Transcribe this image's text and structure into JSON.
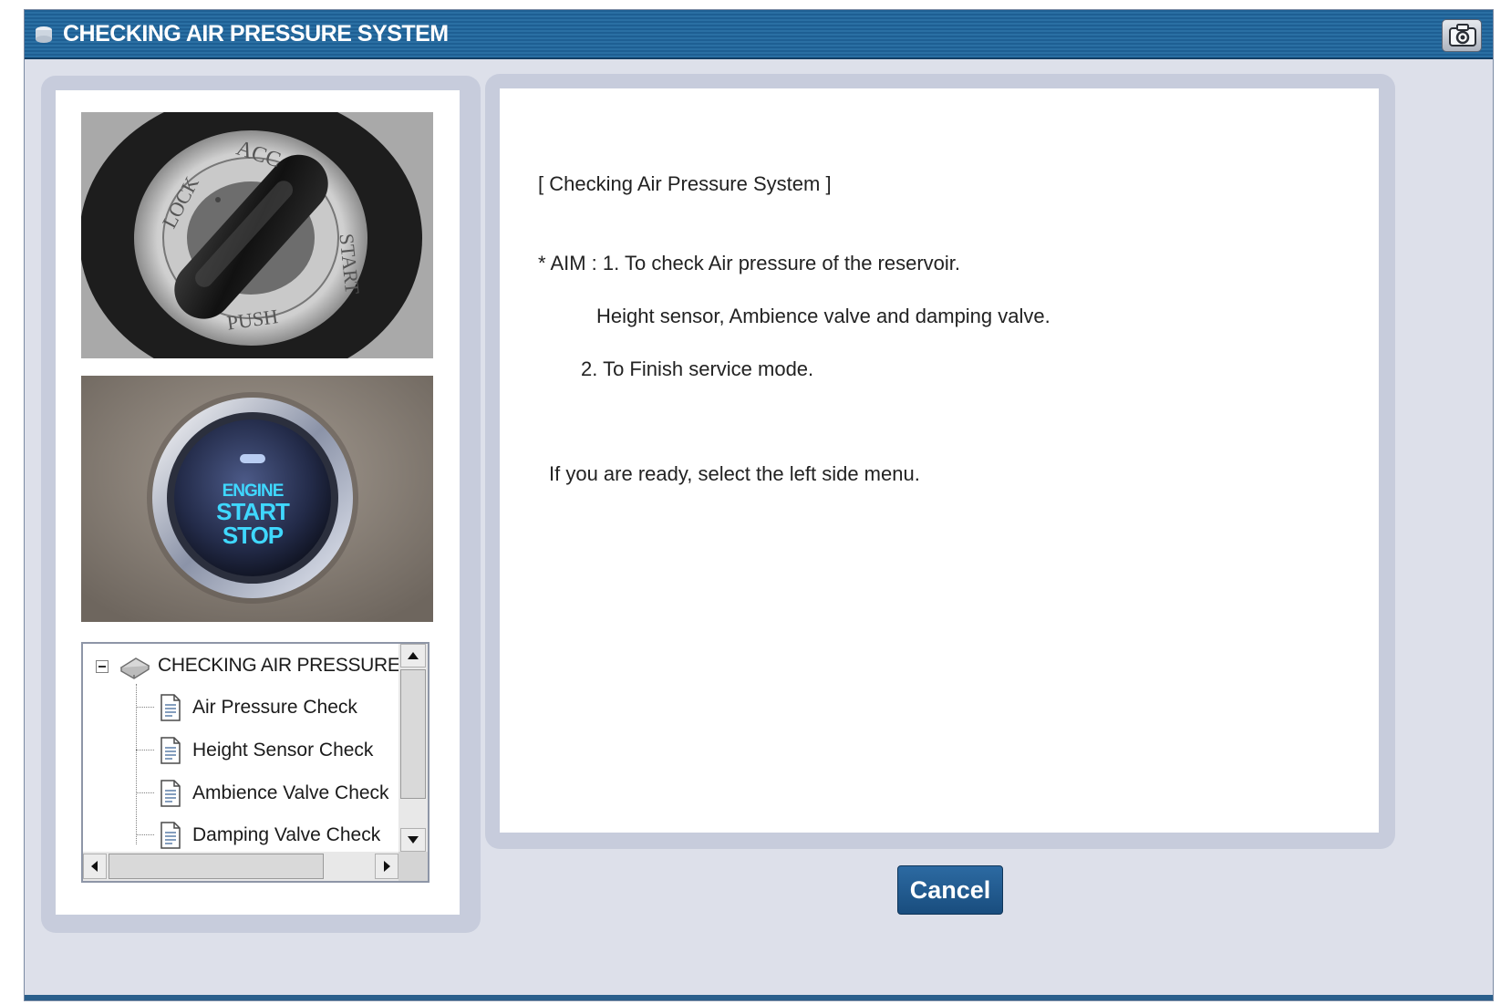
{
  "window": {
    "title": "CHECKING AIR PRESSURE SYSTEM",
    "titlebar_color": "#1e5f93"
  },
  "toolbar": {
    "camera_icon": "camera-icon"
  },
  "tree": {
    "root_label": "CHECKING AIR PRESSURE S",
    "items": [
      {
        "label": "Air Pressure Check"
      },
      {
        "label": "Height Sensor Check"
      },
      {
        "label": "Ambience Valve Check"
      },
      {
        "label": "Damping Valve Check"
      }
    ]
  },
  "photos": {
    "key_switch": {
      "labels": [
        "ACC",
        "LOCK",
        "START",
        "PUSH"
      ]
    },
    "start_button": {
      "lines": [
        "ENGINE",
        "START",
        "STOP"
      ]
    }
  },
  "content": {
    "heading": "[ Checking Air Pressure System ]",
    "aim_line1": "* AIM : 1. To check Air pressure of the reservoir.",
    "aim_line2": "Height sensor, Ambience valve and damping valve.",
    "aim_line3": "2. To Finish service mode.",
    "instruction": "If you are ready, select the left side menu."
  },
  "footer": {
    "cancel_label": "Cancel"
  },
  "colors": {
    "accent": "#1f5a8e",
    "panel_bg": "#c7ccdc",
    "start_glow": "#3fd8ff"
  }
}
